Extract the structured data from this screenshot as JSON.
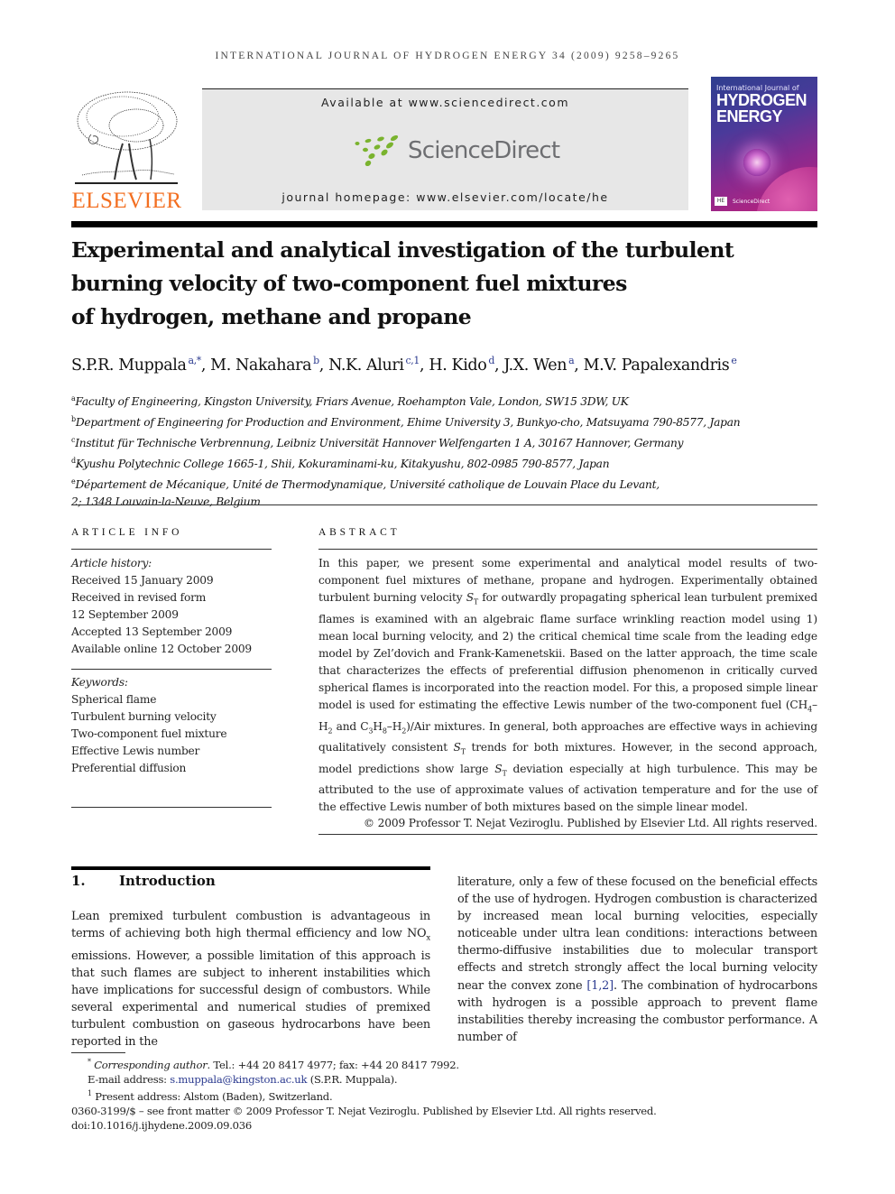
{
  "running_head": "INTERNATIONAL JOURNAL OF HYDROGEN ENERGY 34 (2009) 9258–9265",
  "masthead": {
    "publisher_logo_text": "ELSEVIER",
    "available_at": "Available at www.sciencedirect.com",
    "sciencedirect_logo_text": "ScienceDirect",
    "journal_homepage": "journal homepage: www.elsevier.com/locate/he",
    "cover": {
      "line1": "International Journal of",
      "line2": "HYDROGEN",
      "line3": "ENERGY",
      "badge": "HE",
      "sd_mark": "ScienceDirect"
    },
    "colors": {
      "elsevier_orange": "#f36f21",
      "sciencedirect_green": "#7ab32e",
      "link_blue": "#2b3a8f"
    }
  },
  "title_lines": [
    "Experimental and analytical investigation of the turbulent",
    "burning velocity of two-component fuel mixtures",
    "of hydrogen, methane and propane"
  ],
  "authors": [
    {
      "name": "S.P.R. Muppala",
      "sup": "a,*"
    },
    {
      "name": "M. Nakahara",
      "sup": "b"
    },
    {
      "name": "N.K. Aluri",
      "sup": "c,1"
    },
    {
      "name": "H. Kido",
      "sup": "d"
    },
    {
      "name": "J.X. Wen",
      "sup": "a"
    },
    {
      "name": "M.V. Papalexandris",
      "sup": "e"
    }
  ],
  "affiliations": [
    {
      "key": "a",
      "text": "Faculty of Engineering, Kingston University, Friars Avenue, Roehampton Vale, London, SW15 3DW, UK"
    },
    {
      "key": "b",
      "text": "Department of Engineering for Production and Environment, Ehime University 3, Bunkyo-cho, Matsuyama 790-8577, Japan"
    },
    {
      "key": "c",
      "text": "Institut für Technische Verbrennung, Leibniz Universität Hannover Welfengarten 1 A, 30167 Hannover, Germany"
    },
    {
      "key": "d",
      "text": "Kyushu Polytechnic College 1665-1, Shii, Kokuraminami-ku, Kitakyushu, 802-0985 790-8577, Japan"
    },
    {
      "key": "e",
      "text": "Département de Mécanique, Unité de Thermodynamique, Université catholique de Louvain Place du Levant,"
    },
    {
      "key": "",
      "text": "2; 1348 Louvain-la-Neuve, Belgium"
    }
  ],
  "article_info": {
    "heading": "ARTICLE INFO",
    "history_label": "Article history:",
    "history": [
      "Received 15 January 2009",
      "Received in revised form",
      "12 September 2009",
      "Accepted 13 September 2009",
      "Available online 12 October 2009"
    ],
    "keywords_label": "Keywords:",
    "keywords": [
      "Spherical flame",
      "Turbulent burning velocity",
      "Two-component fuel mixture",
      "Effective Lewis number",
      "Preferential diffusion"
    ]
  },
  "abstract": {
    "heading": "ABSTRACT",
    "p1": "In this paper, we present some experimental and analytical model results of two-component fuel mixtures of methane, propane and hydrogen. Experimentally obtained turbulent burning velocity ",
    "st1": "S",
    "st1_sub": "T",
    "p2": " for outwardly propagating spherical lean turbulent premixed flames is examined with an algebraic flame surface wrinkling reaction model using 1) mean local burning velocity, and 2) the critical chemical time scale from the leading edge model by Zel’dovich and Frank-Kamenetskii. Based on the latter approach, the time scale that characterizes the effects of preferential diffusion phenomenon in critically curved spherical flames is incorporated into the reaction model. For this, a proposed simple linear model is used for estimating the effective Lewis number of the two-component fuel (CH",
    "ch4_sub": "4",
    "p3": "–H",
    "h2_sub_a": "2",
    "p4": " and C",
    "c3_sub": "3",
    "p5": "H",
    "h8_sub": "8",
    "p6": "–H",
    "h2_sub_b": "2",
    "p7": ")/Air mixtures. In general, both approaches are effective ways in achieving qualitatively consistent ",
    "st2": "S",
    "st2_sub": "T",
    "p8": " trends for both mixtures. However, in the second approach, model predictions show large ",
    "st3": "S",
    "st3_sub": "T",
    "p9": " deviation especially at high turbulence. This may be attributed to the use of approximate values of activation temperature and for the use of the effective Lewis number of both mixtures based on the simple linear model.",
    "copyright": "© 2009 Professor T. Nejat Veziroglu. Published by Elsevier Ltd. All rights reserved."
  },
  "introduction": {
    "number": "1.",
    "heading": "Introduction",
    "left_a": "Lean premixed turbulent combustion is advantageous in terms of achieving both high thermal efficiency and low NO",
    "nox_sub": "x",
    "left_b": " emissions. However, a possible limitation of this approach is that such flames are subject to inherent instabilities which have implications for successful design of combustors. While several experimental and numerical studies of premixed turbulent combustion on gaseous hydrocarbons have been reported in the",
    "right_a": "literature, only a few of these focused on the beneficial effects of the use of hydrogen. Hydrogen combustion is characterized by increased mean local burning velocities, especially noticeable under ultra lean conditions: interactions between thermo-diffusive instabilities due to molecular transport effects and stretch strongly affect the local burning velocity near the convex zone ",
    "citation": "[1,2]",
    "right_b": ". The combination of hydrocarbons with hydrogen is a possible approach to prevent flame instabilities thereby increasing the combustor performance. A number of"
  },
  "footnotes": {
    "corr_mark": "*",
    "corr_label": "Corresponding author",
    "corr_text": ". Tel.: +44 20 8417 4977; fax: +44 20 8417 7992.",
    "email_label": "E-mail address: ",
    "email": "s.muppala@kingston.ac.uk",
    "email_after": " (S.P.R. Muppala).",
    "present_mark": "1",
    "present_text": " Present address: Alstom (Baden), Switzerland.",
    "front_matter": "0360-3199/$ – see front matter © 2009 Professor T. Nejat Veziroglu. Published by Elsevier Ltd. All rights reserved.",
    "doi": "doi:10.1016/j.ijhydene.2009.09.036"
  }
}
